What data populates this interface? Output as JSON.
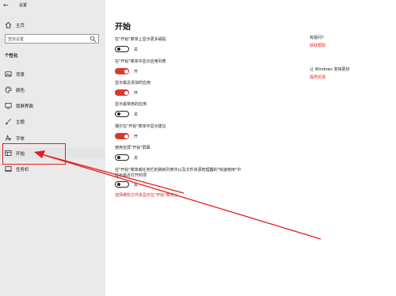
{
  "window": {
    "title": "设置"
  },
  "sidebar": {
    "home_label": "主页",
    "search_placeholder": "查找设置",
    "section_title": "个性化",
    "items": [
      {
        "label": "背景",
        "icon": "picture-icon"
      },
      {
        "label": "颜色",
        "icon": "palette-icon"
      },
      {
        "label": "锁屏界面",
        "icon": "lock-screen-icon"
      },
      {
        "label": "主题",
        "icon": "brush-icon"
      },
      {
        "label": "字体",
        "icon": "font-icon"
      },
      {
        "label": "开始",
        "icon": "start-menu-icon"
      },
      {
        "label": "任务栏",
        "icon": "taskbar-icon"
      }
    ]
  },
  "main": {
    "title": "开始",
    "options": [
      {
        "label": "在\"开始\"菜单上显示更多磁贴",
        "state": "关",
        "on": false
      },
      {
        "label": "在\"开始\"菜单中显示应用列表",
        "state": "开",
        "on": true
      },
      {
        "label": "显示最近添加的应用",
        "state": "开",
        "on": true
      },
      {
        "label": "显示最常用的应用",
        "state": "关",
        "on": false
      },
      {
        "label": "偶尔在\"开始\"菜单中显示建议",
        "state": "开",
        "on": true
      },
      {
        "label": "使用全屏\"开始\"屏幕",
        "state": "关",
        "on": false
      },
      {
        "label_line1": "在\"开始\"菜单或任务栏的跳转列表中以及文件资源管理器的\"快速使用\"中",
        "label_line2": "显示最近打开的项",
        "state": "关",
        "on": false
      }
    ],
    "folders_link": "选择哪些文件夹显示在\"开始\"菜单上"
  },
  "aside": {
    "question": "有疑问?",
    "help_link": "获取帮助",
    "improve": "让 Windows 变得更好",
    "feedback_link": "提供反馈"
  },
  "colors": {
    "accent": "#d73a2c",
    "link": "#dd2222",
    "annotation": "#e02020",
    "sidebar_bg": "#eaeaea"
  }
}
